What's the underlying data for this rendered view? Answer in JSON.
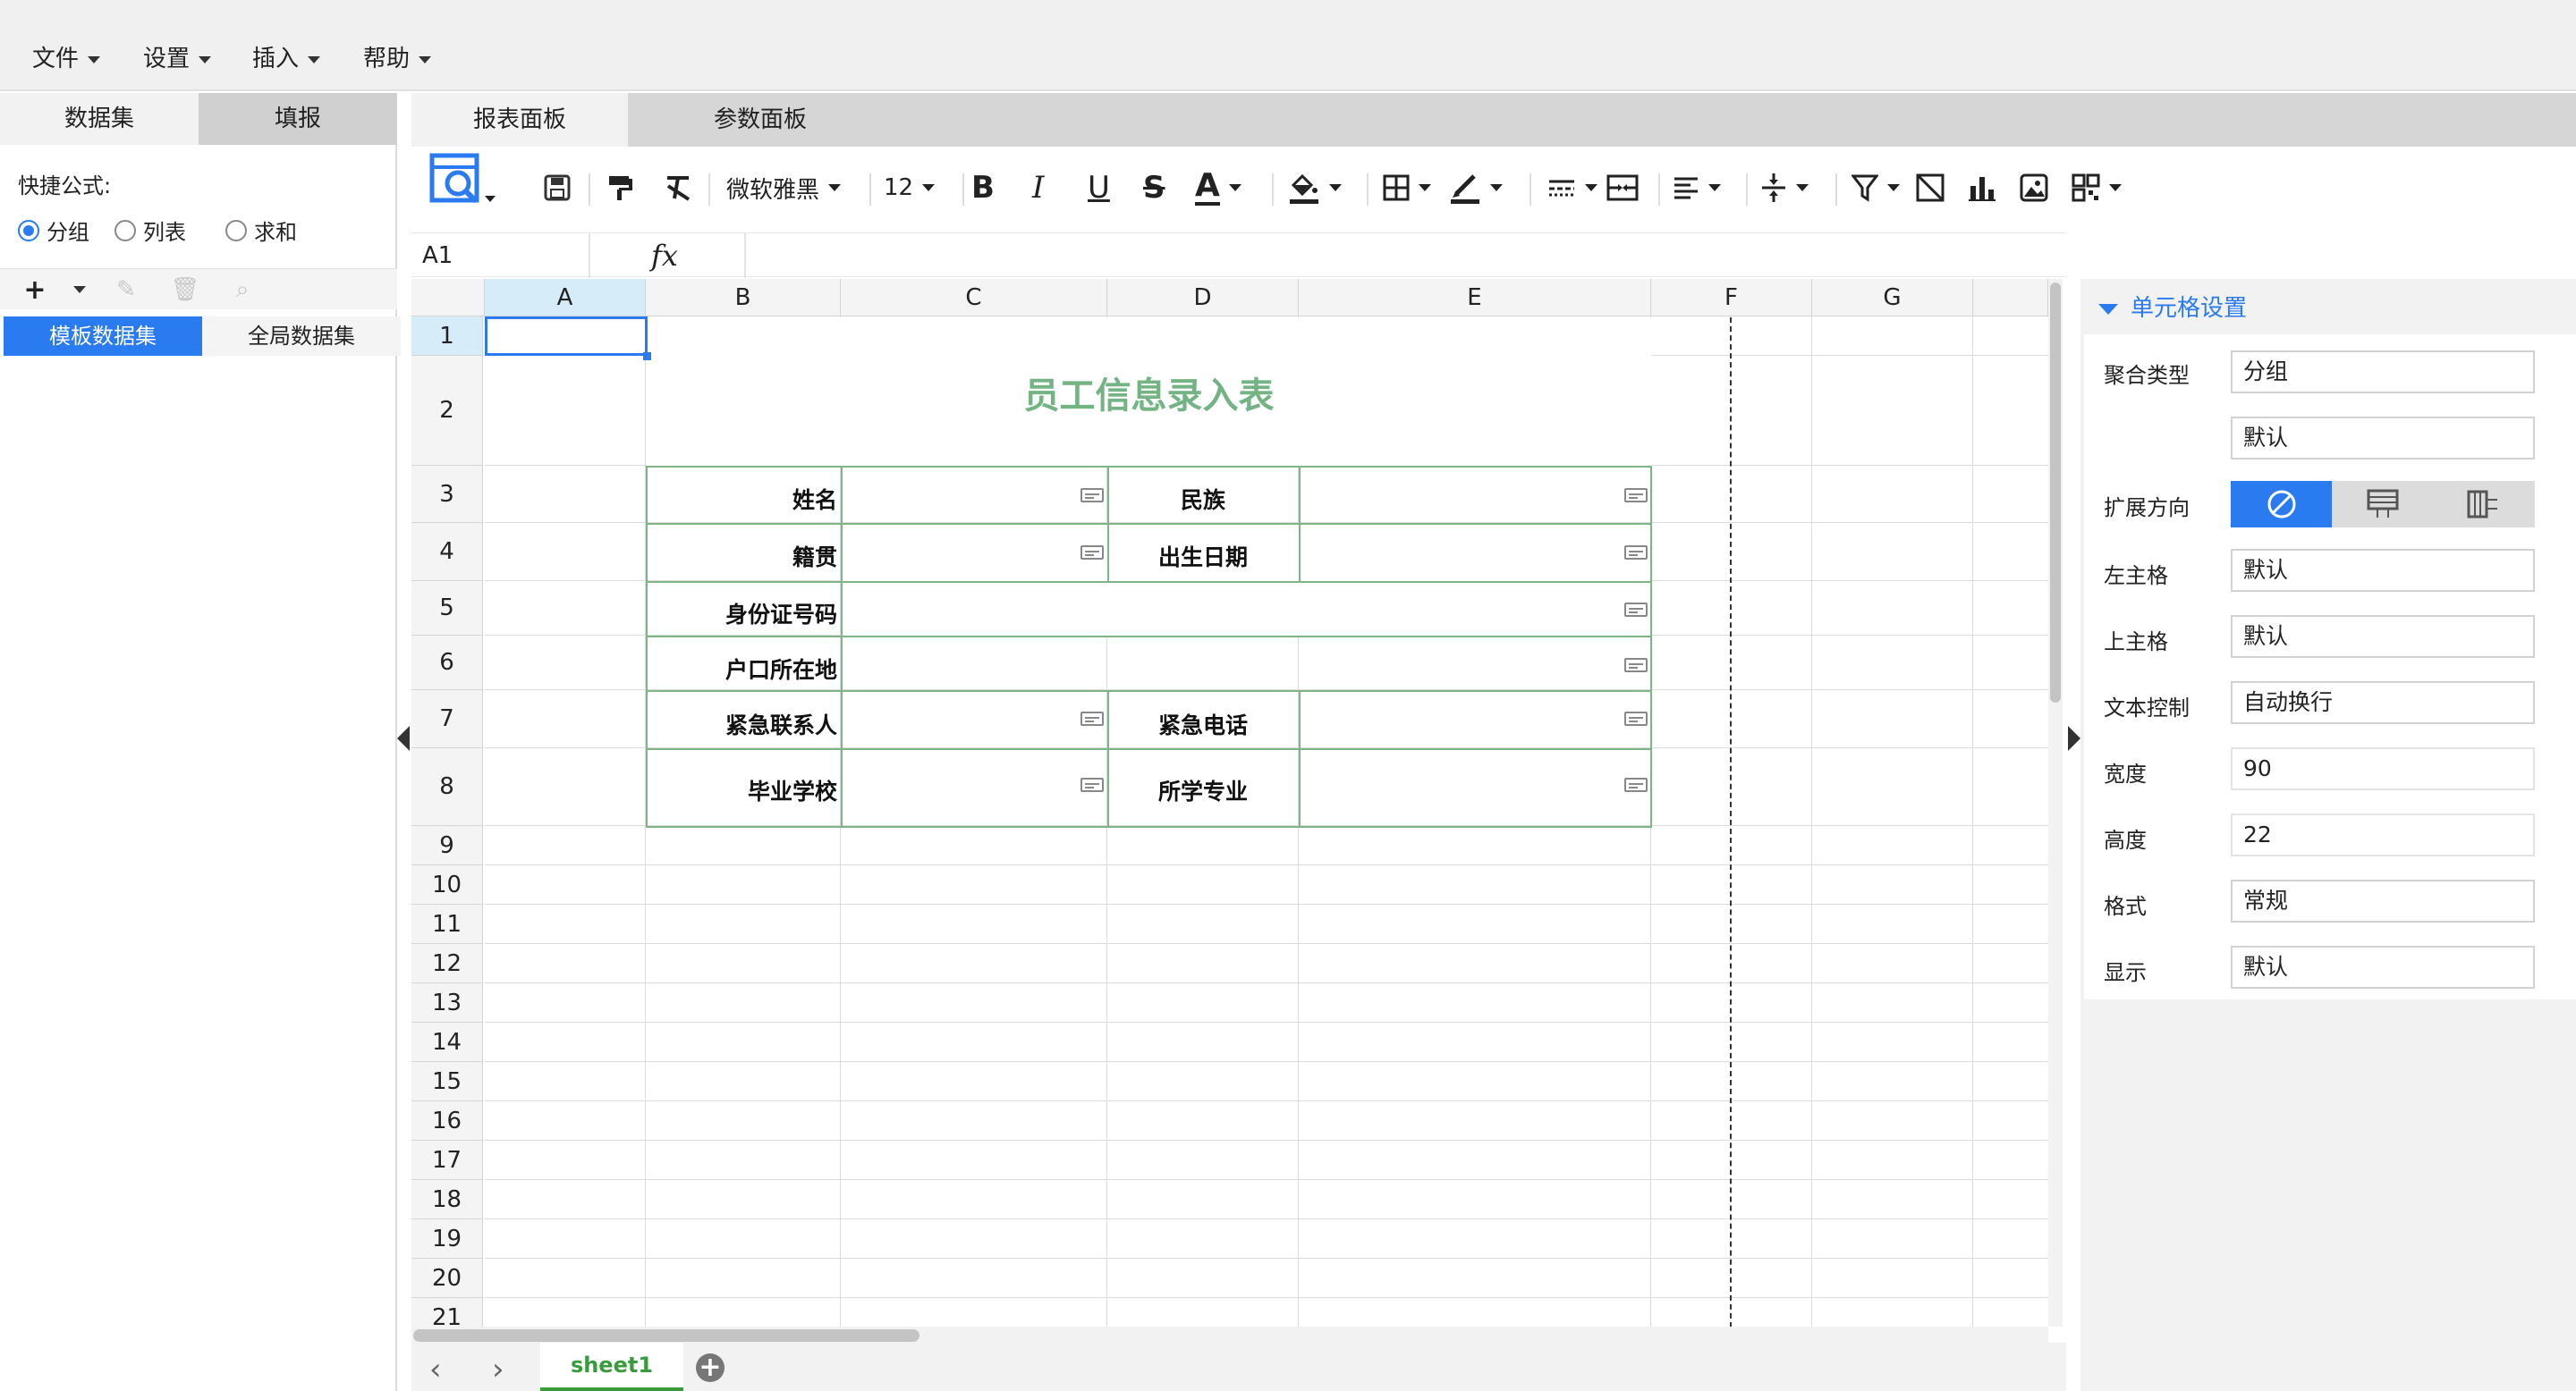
{
  "menubar": {
    "items": [
      {
        "label": "文件"
      },
      {
        "label": "设置"
      },
      {
        "label": "插入"
      },
      {
        "label": "帮助"
      }
    ]
  },
  "left_panel": {
    "tabs": [
      "数据集",
      "填报"
    ],
    "quick_formula_label": "快捷公式:",
    "radios": [
      {
        "label": "分组",
        "checked": true
      },
      {
        "label": "列表",
        "checked": false
      },
      {
        "label": "求和",
        "checked": false
      }
    ],
    "toolbar_icons": [
      "plus-icon",
      "chevron-down-icon",
      "pencil-icon",
      "trash-icon",
      "search-icon"
    ],
    "dataset_tabs": [
      "模板数据集",
      "全局数据集"
    ]
  },
  "main_tabs": [
    "报表面板",
    "参数面板"
  ],
  "toolbar": {
    "font_name": "微软雅黑",
    "font_size": "12",
    "bold": "B",
    "italic": "I",
    "underline": "U",
    "strike": "S",
    "font_color": "A"
  },
  "formula_bar": {
    "cell_ref": "A1",
    "fx": "fx"
  },
  "grid": {
    "columns": [
      "A",
      "B",
      "C",
      "D",
      "E",
      "F",
      "G"
    ],
    "rows": [
      "1",
      "2",
      "3",
      "4",
      "5",
      "6",
      "7",
      "8",
      "9",
      "10",
      "11",
      "12",
      "13",
      "14",
      "15",
      "16",
      "17",
      "18",
      "19",
      "20",
      "21"
    ],
    "title": "员工信息录入表",
    "labels": {
      "name": "姓名",
      "ethnicity": "民族",
      "native_place": "籍贯",
      "birth_date": "出生日期",
      "id_number": "身份证号码",
      "household": "户口所在地",
      "emergency_contact": "紧急联系人",
      "emergency_phone": "紧急电话",
      "school": "毕业学校",
      "major": "所学专业"
    }
  },
  "sheet_bar": {
    "sheet_name": "sheet1",
    "add_label": "+"
  },
  "right_panel": {
    "title": "单元格设置",
    "fields": {
      "agg_type_label": "聚合类型",
      "agg_type_value": "分组",
      "agg_type_value2": "默认",
      "expand_label": "扩展方向",
      "left_parent_label": "左主格",
      "left_parent_value": "默认",
      "top_parent_label": "上主格",
      "top_parent_value": "默认",
      "text_ctrl_label": "文本控制",
      "text_ctrl_value": "自动换行",
      "width_label": "宽度",
      "width_value": "90",
      "height_label": "高度",
      "height_value": "22",
      "format_label": "格式",
      "format_value": "常规",
      "display_label": "显示",
      "display_value": "默认"
    }
  },
  "colors": {
    "accent": "#2a7bf0",
    "title_green": "#74b383",
    "border_green": "#7fb586",
    "sheet_green": "#3a9b3c"
  }
}
